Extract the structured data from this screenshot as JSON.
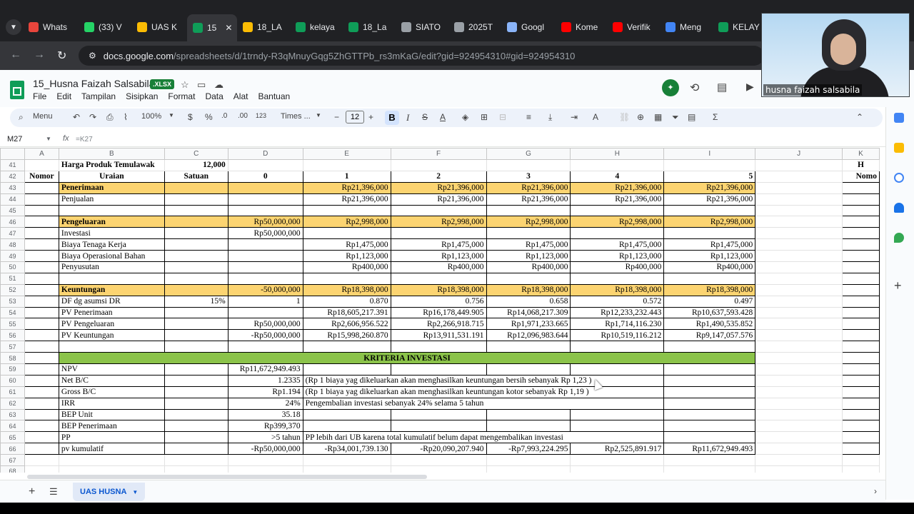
{
  "browser": {
    "tabs": [
      {
        "label": "Whats",
        "icon": "whatsapp-alert-icon",
        "color": "#e8453c"
      },
      {
        "label": "(33) V",
        "icon": "whatsapp-icon",
        "color": "#25d366"
      },
      {
        "label": "UAS K",
        "icon": "google-drive-icon",
        "color": "#fbbc04"
      },
      {
        "label": "15",
        "icon": "google-sheets-icon",
        "color": "#0f9d58"
      },
      {
        "label": "18_LA",
        "icon": "google-drive-icon",
        "color": "#fbbc04"
      },
      {
        "label": "kelaya",
        "icon": "google-sheets-icon",
        "color": "#0f9d58"
      },
      {
        "label": "18_La",
        "icon": "google-sheets-icon",
        "color": "#0f9d58"
      },
      {
        "label": "SIATO",
        "icon": "globe-icon",
        "color": "#9aa0a6"
      },
      {
        "label": "2025T",
        "icon": "globe-icon",
        "color": "#9aa0a6"
      },
      {
        "label": "Googl",
        "icon": "gemini-icon",
        "color": "#8ab4f8"
      },
      {
        "label": "Kome",
        "icon": "youtube-icon",
        "color": "#ff0000"
      },
      {
        "label": "Verifik",
        "icon": "youtube-icon",
        "color": "#ff0000"
      },
      {
        "label": "Meng",
        "icon": "google-icon",
        "color": "#4285f4"
      },
      {
        "label": "KELAY",
        "icon": "google-sheets-icon",
        "color": "#0f9d58"
      }
    ],
    "url_host": "docs.google.com",
    "url_path": "/spreadsheets/d/1trndy-R3qMnuyGqg5ZhGTTPb_rs3mKaG/edit?gid=924954310#gid=924954310"
  },
  "doc": {
    "title": "15_Husna Faizah Salsabila",
    "badge": ".XLSX",
    "menu": [
      "File",
      "Edit",
      "Tampilan",
      "Sisipkan",
      "Format",
      "Data",
      "Alat",
      "Bantuan"
    ]
  },
  "toolbar": {
    "search": "Menu",
    "zoom": "100%",
    "currency": "$",
    "percent": "%",
    "dec_decrease": ".0",
    "dec_increase": ".00",
    "number_format": "123",
    "font": "Times ...",
    "font_size": "12",
    "bold": "B",
    "italic": "I",
    "sum": "Σ"
  },
  "formula": {
    "cell": "M27",
    "content": "=K27"
  },
  "columns": [
    "A",
    "B",
    "C",
    "D",
    "E",
    "F",
    "G",
    "H",
    "I",
    "J",
    "K"
  ],
  "sheet": {
    "r41": {
      "num": "41",
      "b": "Harga Produk Temulawak",
      "c": "12,000"
    },
    "r42": {
      "num": "42",
      "a": "Nomor",
      "b": "Uraian",
      "c": "Satuan",
      "d": "0",
      "e": "1",
      "f": "2",
      "g": "3",
      "h": "4",
      "i": "5",
      "k": "Nomo"
    },
    "r43": {
      "num": "43",
      "b": "Penerimaan",
      "e": "Rp21,396,000",
      "f": "Rp21,396,000",
      "g": "Rp21,396,000",
      "h": "Rp21,396,000",
      "i": "Rp21,396,000"
    },
    "r44": {
      "num": "44",
      "b": "Penjualan",
      "e": "Rp21,396,000",
      "f": "Rp21,396,000",
      "g": "Rp21,396,000",
      "h": "Rp21,396,000",
      "i": "Rp21,396,000"
    },
    "r45": {
      "num": "45"
    },
    "r46": {
      "num": "46",
      "b": "Pengeluaran",
      "d": "Rp50,000,000",
      "e": "Rp2,998,000",
      "f": "Rp2,998,000",
      "g": "Rp2,998,000",
      "h": "Rp2,998,000",
      "i": "Rp2,998,000"
    },
    "r47": {
      "num": "47",
      "b": "Investasi",
      "d": "Rp50,000,000"
    },
    "r48": {
      "num": "48",
      "b": "Biaya Tenaga Kerja",
      "e": "Rp1,475,000",
      "f": "Rp1,475,000",
      "g": "Rp1,475,000",
      "h": "Rp1,475,000",
      "i": "Rp1,475,000"
    },
    "r49": {
      "num": "49",
      "b": "Biaya Operasional Bahan",
      "e": "Rp1,123,000",
      "f": "Rp1,123,000",
      "g": "Rp1,123,000",
      "h": "Rp1,123,000",
      "i": "Rp1,123,000"
    },
    "r50": {
      "num": "50",
      "b": "Penyusutan",
      "e": "Rp400,000",
      "f": "Rp400,000",
      "g": "Rp400,000",
      "h": "Rp400,000",
      "i": "Rp400,000"
    },
    "r51": {
      "num": "51"
    },
    "r52": {
      "num": "52",
      "b": "Keuntungan",
      "d": "-50,000,000",
      "e": "Rp18,398,000",
      "f": "Rp18,398,000",
      "g": "Rp18,398,000",
      "h": "Rp18,398,000",
      "i": "Rp18,398,000"
    },
    "r53": {
      "num": "53",
      "b": "DF dg asumsi DR",
      "c": "15%",
      "d": "1",
      "e": "0.870",
      "f": "0.756",
      "g": "0.658",
      "h": "0.572",
      "i": "0.497"
    },
    "r54": {
      "num": "54",
      "b": "PV Penerimaan",
      "e": "Rp18,605,217.391",
      "f": "Rp16,178,449.905",
      "g": "Rp14,068,217.309",
      "h": "Rp12,233,232.443",
      "i": "Rp10,637,593.428"
    },
    "r55": {
      "num": "55",
      "b": "PV Pengeluaran",
      "d": "Rp50,000,000",
      "e": "Rp2,606,956.522",
      "f": "Rp2,266,918.715",
      "g": "Rp1,971,233.665",
      "h": "Rp1,714,116.230",
      "i": "Rp1,490,535.852"
    },
    "r56": {
      "num": "56",
      "b": "PV Keuntungan",
      "d": "-Rp50,000,000",
      "e": "Rp15,998,260.870",
      "f": "Rp13,911,531.191",
      "g": "Rp12,096,983.644",
      "h": "Rp10,519,116.212",
      "i": "Rp9,147,057.576"
    },
    "r57": {
      "num": "57"
    },
    "r58": {
      "num": "58",
      "title": "KRITERIA INVESTASI"
    },
    "r59": {
      "num": "59",
      "b": "NPV",
      "d": "Rp11,672,949.493"
    },
    "r60": {
      "num": "60",
      "b": "Net B/C",
      "d": "1.2335",
      "note": "(Rp 1 biaya yag dikeluarkan akan menghasilkan keuntungan bersih sebanyak Rp 1,23 )"
    },
    "r61": {
      "num": "61",
      "b": "Gross B/C",
      "d": "Rp1.194",
      "note": "(Rp 1 biaya yag dikeluarkan akan menghasilkan keuntungan kotor sebanyak Rp 1,19 )"
    },
    "r62": {
      "num": "62",
      "b": "IRR",
      "d": "24%",
      "note": "Pengembalian investasi sebanyak 24% selama 5 tahun"
    },
    "r63": {
      "num": "63",
      "b": "BEP Unit",
      "d": "35.18"
    },
    "r64": {
      "num": "64",
      "b": "BEP Penerimaan",
      "d": "Rp399,370"
    },
    "r65": {
      "num": "65",
      "b": "PP",
      "d": ">5 tahun",
      "note": "PP lebih dari UB karena total kumulatif belum dapat mengembalikan investasi"
    },
    "r66": {
      "num": "66",
      "b": "pv kumulatif",
      "d": "-Rp50,000,000",
      "e": "-Rp34,001,739.130",
      "f": "-Rp20,090,207.940",
      "g": "-Rp7,993,224.295",
      "h": "Rp2,525,891.917",
      "i": "Rp11,672,949.493"
    },
    "r67": {
      "num": "67"
    },
    "r68": {
      "num": "68"
    },
    "k_header_top": "H"
  },
  "sheet_tab": "UAS HUSNA",
  "webcam": {
    "name": "husna faizah salsabila"
  },
  "colors": {
    "header_yellow": "#fcd471",
    "criteria_green": "#8bc34a",
    "sheets_green": "#0f9d58"
  }
}
